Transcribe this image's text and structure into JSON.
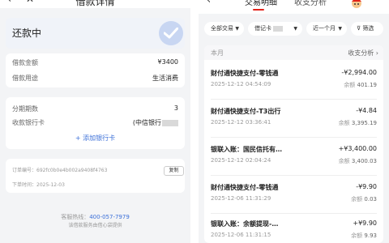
{
  "left": {
    "title": "借款详情",
    "status": "还款中",
    "loan": {
      "amount_label": "借款金额",
      "amount_value": "¥3400",
      "purpose_label": "借款用途",
      "purpose_value": "生活消费"
    },
    "repay": {
      "periods_label": "分期期数",
      "periods_value": "3",
      "card_label": "收款银行卡",
      "card_value": "(中信银行",
      "add_card": "+ 添加银行卡"
    },
    "order": {
      "no_label": "订单编号：",
      "no_value": "692fc0b0e4b002a9408f4763",
      "copy": "复制",
      "time_label": "下单时间：",
      "time_value": "2025-12-03"
    },
    "hotline_label": "客服热线：",
    "hotline_number": "400-057-7979",
    "hotline_note": "该借款服务由借心袋提供"
  },
  "right": {
    "tabs": [
      "交易明细",
      "收支分析"
    ],
    "filters": [
      "全部交易",
      "借记卡",
      "近一个月",
      "筛选"
    ],
    "month_label": "本月",
    "analysis_label": "收支分析 ›",
    "balance_prefix": "余额",
    "transactions": [
      {
        "name": "财付通快捷支付-零钱通",
        "time": "2025-12-12 04:54:09",
        "amount": "-¥2,994.00",
        "balance": "401.19"
      },
      {
        "name": "财付通快捷支付-T3出行",
        "time": "2025-12-12 03:36:41",
        "amount": "-¥4.84",
        "balance": "3,395.19"
      },
      {
        "name": "银联入账：国民信托有…",
        "time": "2025-12-12 02:04:24",
        "amount": "+¥3,400.00",
        "balance": "3,400.03"
      },
      {
        "name": "财付通快捷支付-零钱通",
        "time": "2025-12-06 11:31:29",
        "amount": "-¥9.90",
        "balance": "0.03"
      },
      {
        "name": "银联入账：余额提现-…",
        "time": "2025-12-06 11:31:15",
        "amount": "+¥9.90",
        "balance": "9.93"
      }
    ]
  },
  "colors": {
    "accent": "#e2231a",
    "link": "#3b6fd8",
    "panel": "#f3f4f6"
  }
}
